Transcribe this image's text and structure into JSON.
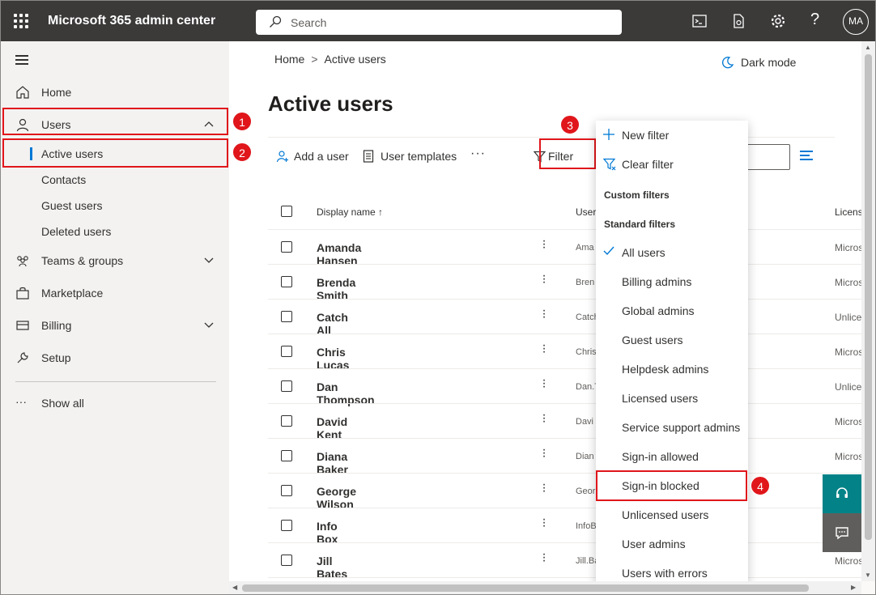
{
  "app": {
    "title": "Microsoft 365 admin center",
    "avatar_initials": "MA"
  },
  "search": {
    "placeholder": "Search"
  },
  "sidebar": {
    "items": [
      {
        "label": "Home"
      },
      {
        "label": "Users"
      },
      {
        "label": "Teams & groups"
      },
      {
        "label": "Marketplace"
      },
      {
        "label": "Billing"
      },
      {
        "label": "Setup"
      }
    ],
    "users_sub": [
      "Active users",
      "Contacts",
      "Guest users",
      "Deleted users"
    ],
    "show_all": "Show all"
  },
  "breadcrumb": {
    "home": "Home",
    "sep": ">",
    "current": "Active users"
  },
  "dark_mode_label": "Dark mode",
  "page_title": "Active users",
  "commands": {
    "add_user": "Add a user",
    "user_templates": "User templates",
    "more": "···",
    "filter": "Filter"
  },
  "table": {
    "headers": {
      "display_name": "Display name ↑",
      "username": "User",
      "licenses": "Licens"
    },
    "rows": [
      {
        "name": "Amanda Hansen",
        "user": "Ama",
        "lic": "Micros"
      },
      {
        "name": "Brenda Smith",
        "user": "Bren",
        "lic": "Micros"
      },
      {
        "name": "Catch All",
        "user": "Catch",
        "lic": "Unlice"
      },
      {
        "name": "Chris Lucas",
        "user": "Chris",
        "lic": "Micros"
      },
      {
        "name": "Dan Thompson",
        "user": "Dan.T",
        "lic": "Unlice"
      },
      {
        "name": "David Kent",
        "user": "Davi",
        "lic": "Micros"
      },
      {
        "name": "Diana Baker",
        "user": "Dian",
        "lic": "Micros"
      },
      {
        "name": "George Wilson",
        "user": "Geor",
        "lic": "Micros"
      },
      {
        "name": "Info Box",
        "user": "InfoB",
        "lic": ""
      },
      {
        "name": "Jill Bates",
        "user": "Jill.Ba",
        "lic": "Micros"
      }
    ]
  },
  "filter_menu": {
    "new_filter": "New filter",
    "clear_filter": "Clear filter",
    "custom_header": "Custom filters",
    "standard_header": "Standard filters",
    "standard": [
      "All users",
      "Billing admins",
      "Global admins",
      "Guest users",
      "Helpdesk admins",
      "Licensed users",
      "Service support admins",
      "Sign-in allowed",
      "Sign-in blocked",
      "Unlicensed users",
      "User admins",
      "Users with errors"
    ],
    "checked": "All users"
  },
  "badges": [
    "1",
    "2",
    "3",
    "4"
  ],
  "colors": {
    "highlight": "#e0161b",
    "accent": "#0078d4",
    "topbar": "#3b3a39",
    "fab_teal": "#038387",
    "fab_gray": "#605e5c"
  }
}
